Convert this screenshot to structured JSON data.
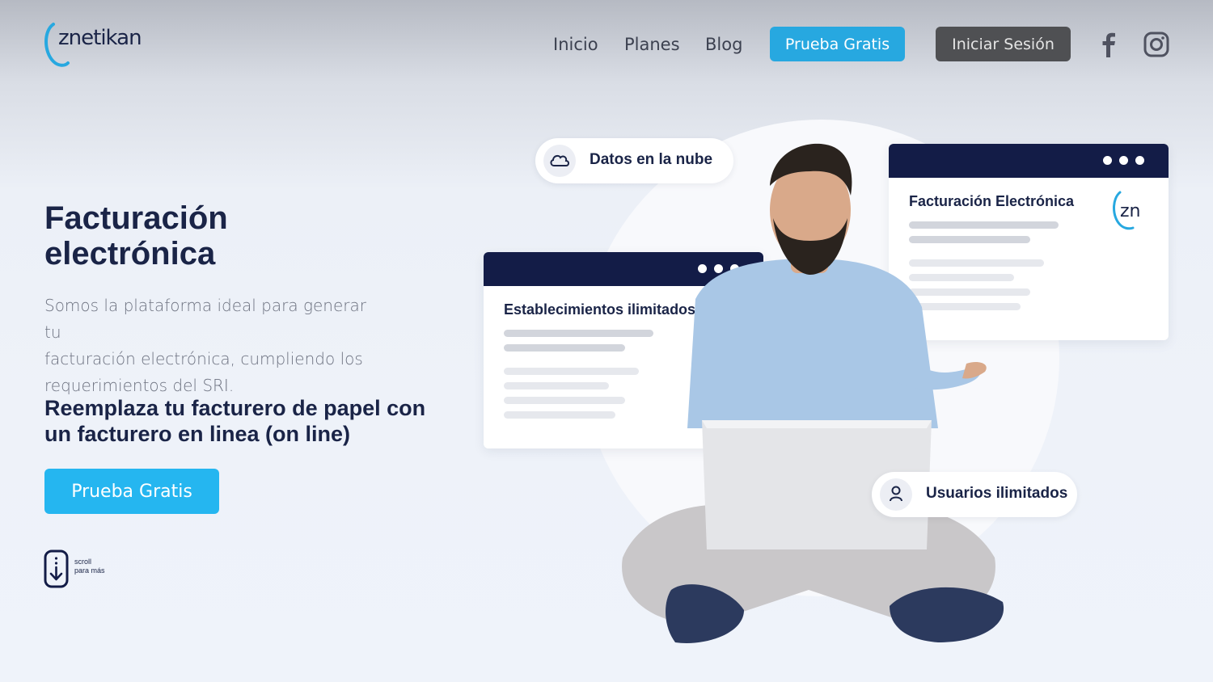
{
  "header": {
    "logo_text": "znetikan",
    "nav": [
      "Inicio",
      "Planes",
      "Blog"
    ],
    "trial_button": "Prueba Gratis",
    "login_button": "Iniciar Sesión"
  },
  "hero": {
    "title_line1": "Facturación",
    "title_line2": "electrónica",
    "description_line1": "Somos la plataforma ideal para generar tu",
    "description_line2": "facturación electrónica, cumpliendo los",
    "description_line3": "requerimientos del SRI.",
    "subtitle_line1": "Reemplaza tu facturero de papel con",
    "subtitle_line2": "un facturero en linea (on line)",
    "cta": "Prueba Gratis",
    "scroll_line1": "scroll",
    "scroll_line2": "para más"
  },
  "illustration": {
    "pill_cloud": "Datos en la nube",
    "pill_users": "Usuarios ilimitados",
    "card_left_title": "Establecimientos ilimitados",
    "card_right_title": "Facturación Electrónica",
    "card_logo_text": "zn"
  },
  "colors": {
    "navy": "#131c47",
    "accent": "#27a8e0",
    "button_dark": "#4f5053"
  }
}
